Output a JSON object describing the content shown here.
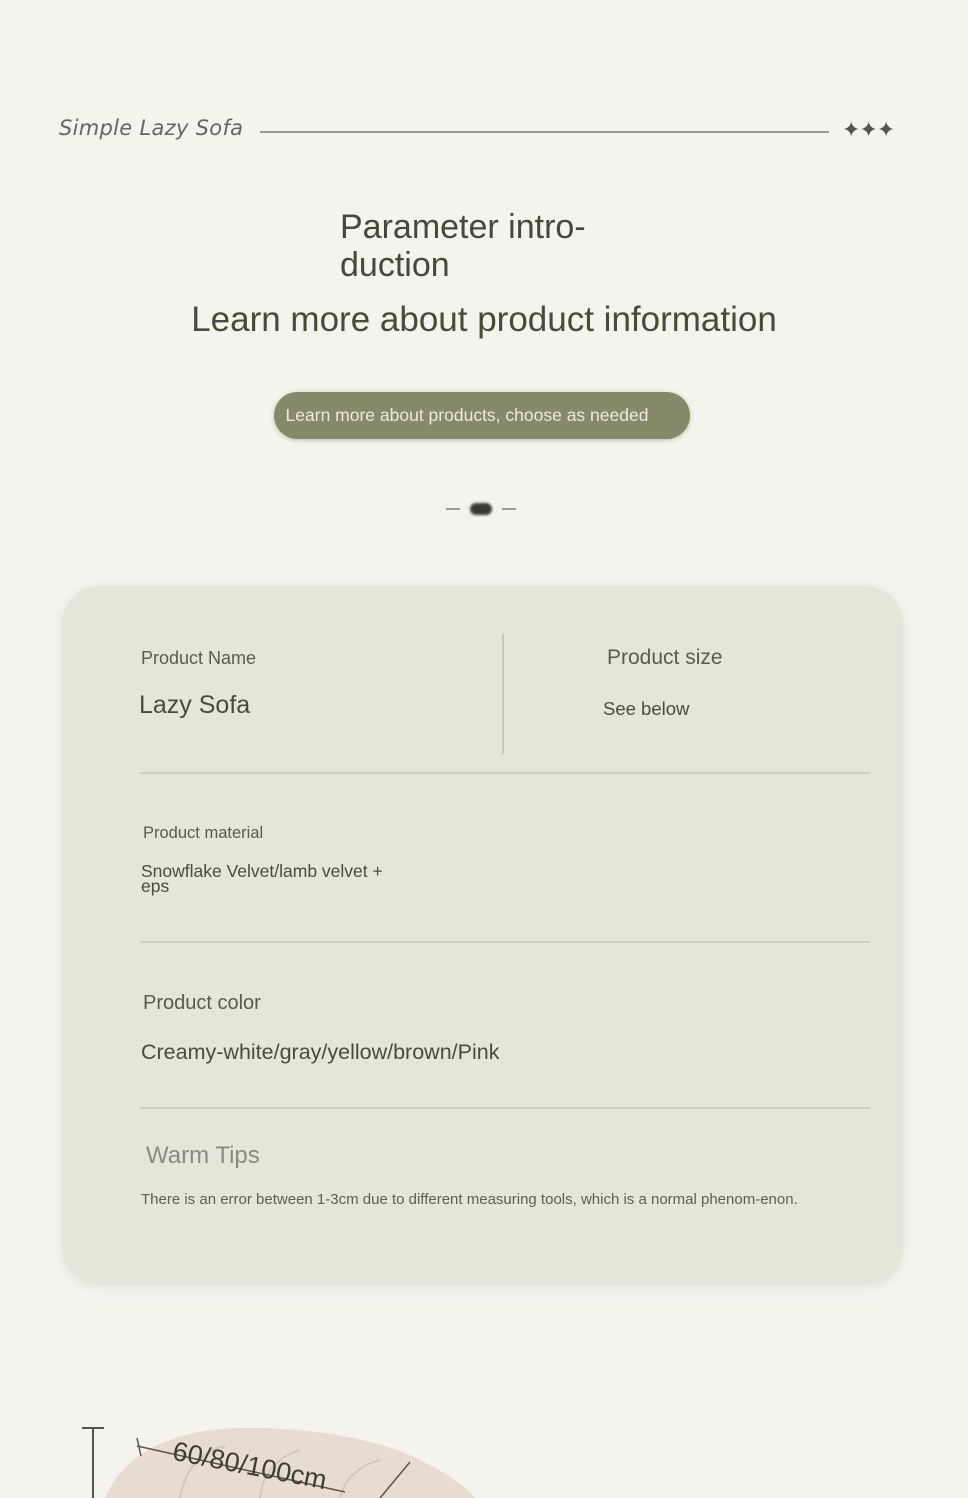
{
  "header": {
    "brand": "Simple Lazy Sofa",
    "stars": "✦✦✦"
  },
  "intro": {
    "title": "Parameter intro-duction",
    "subtitle": "Learn more about product information",
    "pill": "Learn more about products, choose as needed"
  },
  "params": {
    "name_label": "Product Name",
    "name_value": "Lazy Sofa",
    "size_label": "Product size",
    "size_value": "See below",
    "material_label": "Product material",
    "material_value": "Snowflake Velvet/lamb velvet + eps",
    "color_label": "Product color",
    "color_value": "Creamy-white/gray/yellow/brown/Pink",
    "tips_label": "Warm Tips",
    "tips_value": "There is an error between 1-3cm due to different measuring tools, which is a normal phenom-enon."
  },
  "dimension": {
    "label": "60/80/100cm"
  },
  "colors": {
    "background": "#f4f3ec",
    "card": "#e6e5d9",
    "pill": "#878a6a",
    "text": "#4a4a3e"
  }
}
